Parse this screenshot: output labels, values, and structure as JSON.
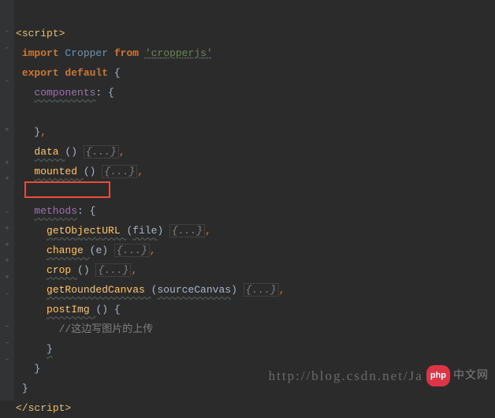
{
  "gutter": {
    "icons": [
      "–",
      "–",
      "",
      "–",
      "",
      "",
      "+",
      "",
      "+",
      "+",
      "",
      "–",
      "+",
      "+",
      "+",
      "+",
      "–",
      "",
      "–",
      "–",
      "–",
      "",
      ""
    ]
  },
  "code": {
    "l1_open": "<",
    "l1_tag": "script",
    "l1_close": ">",
    "l2_import": "import",
    "l2_class": " Cropper ",
    "l2_from": "from ",
    "l2_str": "'cropperjs'",
    "l3_export": "export ",
    "l3_default": "default ",
    "l3_brace": "{",
    "l4_prop": "components",
    "l4_colon": ": ",
    "l4_brace": "{",
    "l7_close": "}",
    "l7_comma": ",",
    "l8_fn": "data ",
    "l8_paren": "() ",
    "l8_fold": "{...}",
    "l8_comma": ",",
    "l9_fn": "mounted ",
    "l9_paren": "() ",
    "l9_fold": "{...}",
    "l9_comma": ",",
    "l11_prop": "methods",
    "l11_colon": ": ",
    "l11_brace": "{",
    "l12_fn": "getObjectURL ",
    "l12_popen": "(",
    "l12_param": "file",
    "l12_pclose": ") ",
    "l12_fold": "{...}",
    "l12_comma": ",",
    "l13_fn": "change ",
    "l13_popen": "(",
    "l13_param": "e",
    "l13_pclose": ") ",
    "l13_fold": "{...}",
    "l13_comma": ",",
    "l14_fn": "crop ",
    "l14_paren": "() ",
    "l14_fold": "{...}",
    "l14_comma": ",",
    "l15_fn": "getRoundedCanvas ",
    "l15_popen": "(",
    "l15_param": "sourceCanvas",
    "l15_pclose": ") ",
    "l15_fold": "{...}",
    "l15_comma": ",",
    "l16_fn": "postImg ",
    "l16_paren": "() ",
    "l16_brace": "{",
    "l17_comment": "//这边写图片的上传",
    "l18_close": "}",
    "l19_close": "}",
    "l20_close": "}",
    "l21_open": "</",
    "l21_tag": "script",
    "l21_close": ">"
  },
  "watermark": {
    "url": "http://blog.csdn.net/Ja",
    "php": "php",
    "cn": "中文网"
  }
}
